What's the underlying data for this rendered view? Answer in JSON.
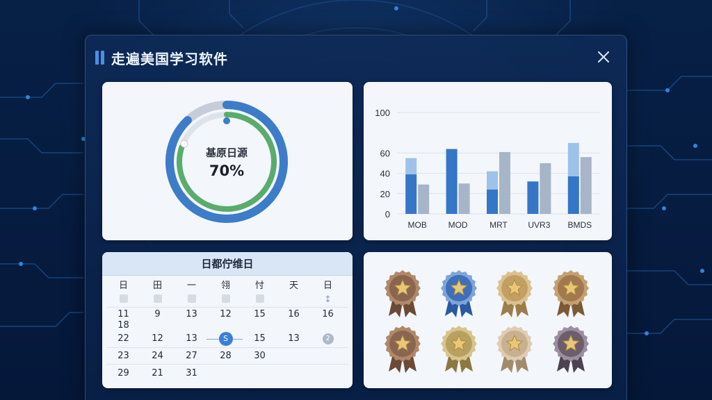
{
  "window": {
    "title": "走遍美国学习软件",
    "close_icon": "close-icon"
  },
  "donut_card": {
    "label": "基原日源",
    "value": "70%",
    "progress": 0.7,
    "colors": {
      "outer": "#3d7cc9",
      "inner": "#5aac6c",
      "track": "#c6cdd8"
    }
  },
  "chart_data": {
    "type": "bar",
    "categories": [
      "MOB",
      "MOD",
      "MRT",
      "UVR3",
      "BMDS"
    ],
    "series": [
      {
        "values": [
          39,
          64,
          24,
          32,
          37
        ],
        "stack_top": [
          55,
          64,
          42,
          32,
          70
        ],
        "color": "#3576c6",
        "top_color": "#9ec2e8"
      },
      {
        "values": [
          29,
          30,
          61,
          50,
          56
        ],
        "color": "#a7b5c8"
      }
    ],
    "y_ticks": [
      "0",
      "20",
      "40",
      "60",
      "100"
    ],
    "ylim": [
      0,
      100
    ],
    "grid": true
  },
  "calendar": {
    "title": "日都佇维日",
    "weekdays": [
      "日",
      "田",
      "一",
      "翎",
      "忖",
      "天",
      "日"
    ],
    "rows": [
      [
        "11",
        "9",
        "13",
        "12",
        "15",
        "16",
        "16"
      ],
      [
        "18",
        "",
        "",
        "",
        "",
        "",
        ""
      ],
      [
        "22",
        "12",
        "13",
        "S",
        "15",
        "13",
        "2"
      ],
      [
        "23",
        "24",
        "27",
        "28",
        "30",
        "",
        ""
      ],
      [
        "29",
        "21",
        "31",
        "",
        "",
        "",
        ""
      ]
    ]
  },
  "badges": [
    {
      "color": "#8a6650",
      "ring": "#b08868",
      "ribbon": "#6b4a36"
    },
    {
      "color": "#3f6fb8",
      "ring": "#7ea4d8",
      "ribbon": "#2c5aa0"
    },
    {
      "color": "#c2a064",
      "ring": "#dcc190",
      "ribbon": "#9c7c48"
    },
    {
      "color": "#a07a4e",
      "ring": "#c4a070",
      "ribbon": "#7c5a36"
    },
    {
      "color": "#8a6650",
      "ring": "#b08868",
      "ribbon": "#6b4a36"
    },
    {
      "color": "#b8a060",
      "ring": "#d8c48c",
      "ribbon": "#8c7840"
    },
    {
      "color": "#c8b090",
      "ring": "#e0ccb0",
      "ribbon": "#a08c6c"
    },
    {
      "color": "#6c5e6a",
      "ring": "#9a8ea0",
      "ribbon": "#4c4250"
    }
  ]
}
